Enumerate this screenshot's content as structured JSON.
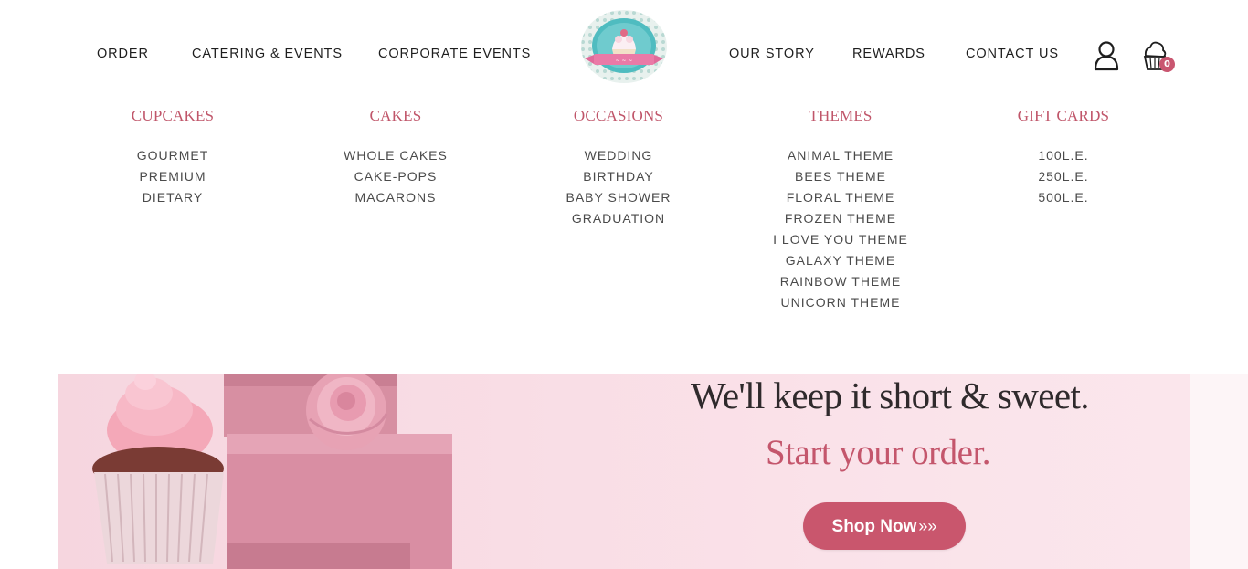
{
  "nav": {
    "left": [
      "ORDER",
      "CATERING & EVENTS",
      "CORPORATE EVENTS"
    ],
    "right": [
      "OUR STORY",
      "REWARDS",
      "CONTACT US"
    ]
  },
  "logo": {
    "icon": "cupcake-logo"
  },
  "account": {
    "icon": "user-icon"
  },
  "cart": {
    "icon": "cart-cupcake-icon",
    "count": "0"
  },
  "mega_menu": [
    {
      "heading": "CUPCAKES",
      "items": [
        "GOURMET",
        "PREMIUM",
        "DIETARY"
      ]
    },
    {
      "heading": "CAKES",
      "items": [
        "WHOLE CAKES",
        "CAKE-POPS",
        "MACARONS"
      ]
    },
    {
      "heading": "OCCASIONS",
      "items": [
        "WEDDING",
        "BIRTHDAY",
        "BABY SHOWER",
        "GRADUATION"
      ]
    },
    {
      "heading": "THEMES",
      "items": [
        "ANIMAL THEME",
        "BEES THEME",
        "FLORAL THEME",
        "FROZEN THEME",
        "I LOVE YOU THEME",
        "GALAXY THEME",
        "RAINBOW THEME",
        "UNICORN THEME"
      ]
    },
    {
      "heading": "GIFT CARDS",
      "items": [
        "100L.E.",
        "250L.E.",
        "500L.E."
      ]
    }
  ],
  "banner": {
    "title": "We'll keep it short & sweet.",
    "subtitle": "Start your order.",
    "button": "Shop Now",
    "button_arrows": "»»"
  },
  "colors": {
    "accent": "#c0566a",
    "button": "#c9566d",
    "banner_bg": "#f8dbe3"
  }
}
